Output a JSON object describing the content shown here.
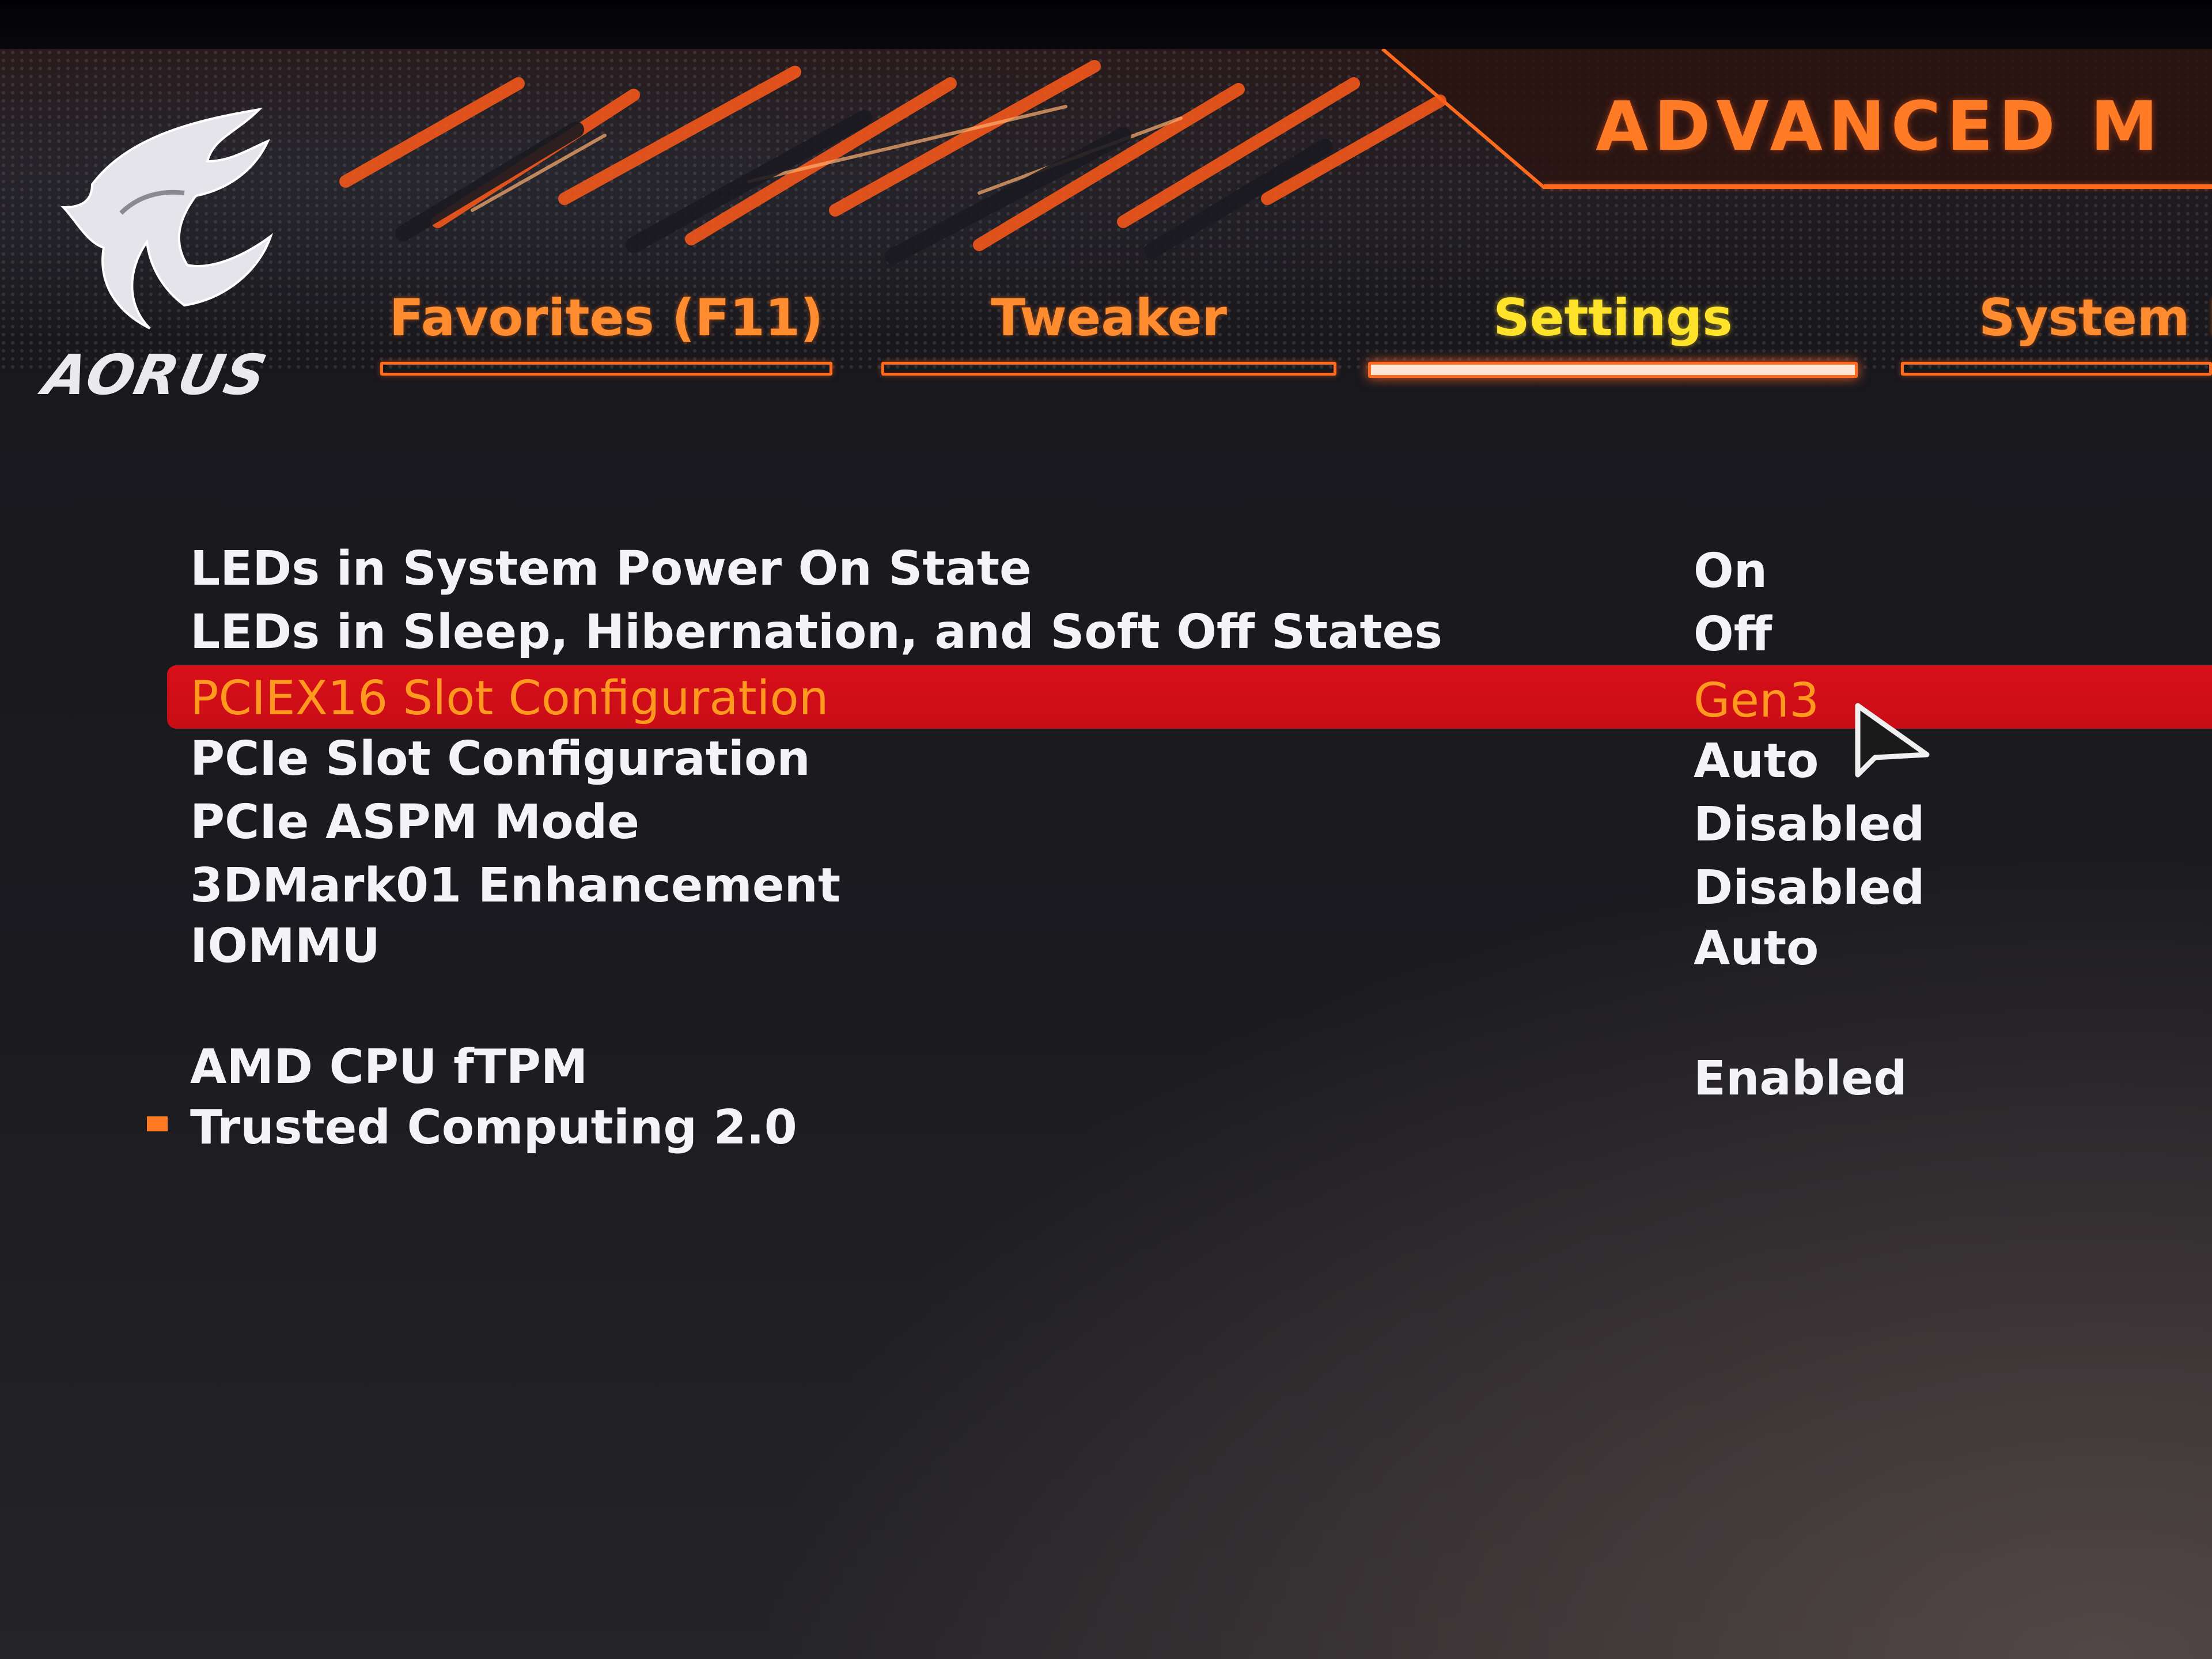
{
  "header": {
    "logo_text": "AORUS",
    "section_title": "ADVANCED M"
  },
  "tabs": [
    {
      "label": "Favorites (F11)",
      "active": false
    },
    {
      "label": "Tweaker",
      "active": false
    },
    {
      "label": "Settings",
      "active": true
    },
    {
      "label": "System In",
      "active": false
    }
  ],
  "settings": [
    {
      "label": "LEDs in System Power On State",
      "value": "On"
    },
    {
      "label": "LEDs in Sleep, Hibernation, and Soft Off States",
      "value": "Off"
    },
    {
      "label": "PCIEX16 Slot Configuration",
      "value": "Gen3",
      "selected": true
    },
    {
      "label": "PCIe Slot Configuration",
      "value": "Auto"
    },
    {
      "label": "PCIe ASPM Mode",
      "value": "Disabled"
    },
    {
      "label": "3DMark01 Enhancement",
      "value": "Disabled"
    },
    {
      "label": "IOMMU",
      "value": "Auto"
    },
    {
      "label": "AMD CPU fTPM",
      "value": "Enabled"
    },
    {
      "label": "Trusted Computing 2.0",
      "submenu": true
    }
  ],
  "colors": {
    "accent_orange": "#ff7b26",
    "active_tab_yellow": "#ffe32a",
    "selection_red": "#d8101a",
    "text_white": "#f4f4f6"
  },
  "icons": {
    "logo": "aorus-eagle-icon",
    "cursor": "mouse-pointer-icon",
    "submenu_bullet": "square-bullet-icon"
  }
}
